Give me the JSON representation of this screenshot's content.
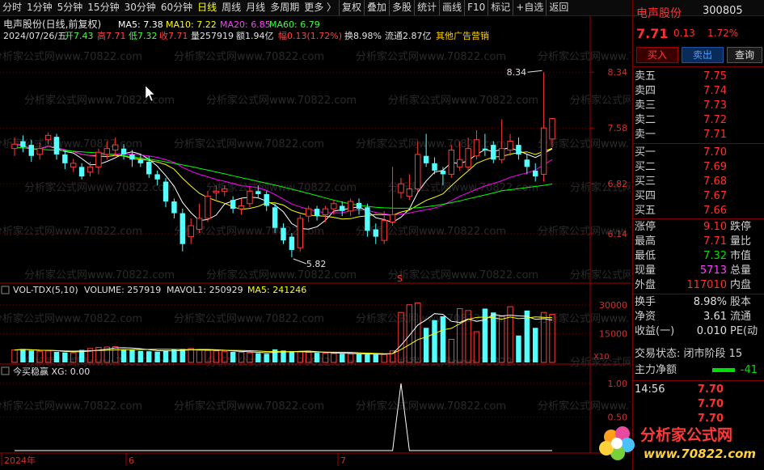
{
  "toolbar": {
    "items": [
      "分时",
      "1分钟",
      "5分钟",
      "15分钟",
      "30分钟",
      "60分钟",
      "日线",
      "周线",
      "月线",
      "多周期",
      "更多 〉",
      "复权",
      "叠加",
      "多股",
      "统计",
      "画线",
      "F10",
      "标记",
      "+自选",
      "返回"
    ],
    "active": "日线"
  },
  "header": {
    "title": "电声股份(日线,前复权)",
    "ma5": "MA5: 7.38",
    "ma10": "MA10: 7.22",
    "ma20": "MA20: 6.85",
    "ma60": "MA60: 6.79",
    "date": "2024/07/26/五",
    "open": "开7.43",
    "high": "高7.71",
    "low": "低7.32",
    "close": "收7.71",
    "vol": "量257919",
    "amount": "额1.94亿",
    "amp": "幅0.13(1.72%)",
    "turnover": "换8.98%",
    "float": "流通2.87亿",
    "sector": "其他广告营销"
  },
  "watermark": "分析家公式网www.70822.com",
  "chart_data": {
    "type": "candlestick",
    "yaxis_ticks": [
      "8.34",
      "7.58",
      "6.82",
      "6.14"
    ],
    "ylim": [
      5.6,
      8.64
    ],
    "high_label": "8.34",
    "low_label": "5.82",
    "marker": "S",
    "candles": [
      {
        "o": 7.3,
        "c": 7.36,
        "h": 7.45,
        "l": 7.2
      },
      {
        "o": 7.4,
        "c": 7.32,
        "h": 7.48,
        "l": 7.25
      },
      {
        "o": 7.35,
        "c": 7.2,
        "h": 7.42,
        "l": 7.12
      },
      {
        "o": 7.22,
        "c": 7.3,
        "h": 7.38,
        "l": 7.15
      },
      {
        "o": 7.42,
        "c": 7.48,
        "h": 7.52,
        "l": 7.36
      },
      {
        "o": 7.46,
        "c": 7.22,
        "h": 7.5,
        "l": 7.15
      },
      {
        "o": 7.22,
        "c": 7.1,
        "h": 7.28,
        "l": 7.02
      },
      {
        "o": 7.05,
        "c": 7.1,
        "h": 7.16,
        "l": 6.98
      },
      {
        "o": 7.05,
        "c": 6.92,
        "h": 7.1,
        "l": 6.88
      },
      {
        "o": 6.98,
        "c": 7.05,
        "h": 7.12,
        "l": 6.92
      },
      {
        "o": 7.05,
        "c": 7.25,
        "h": 7.3,
        "l": 6.95
      },
      {
        "o": 7.22,
        "c": 7.3,
        "h": 7.4,
        "l": 7.15
      },
      {
        "o": 7.28,
        "c": 7.35,
        "h": 7.45,
        "l": 7.2
      },
      {
        "o": 7.3,
        "c": 7.22,
        "h": 7.36,
        "l": 7.15
      },
      {
        "o": 7.22,
        "c": 7.15,
        "h": 7.28,
        "l": 7.05
      },
      {
        "o": 7.15,
        "c": 7.1,
        "h": 7.22,
        "l": 7.05
      },
      {
        "o": 7.12,
        "c": 6.95,
        "h": 7.2,
        "l": 6.9
      },
      {
        "o": 6.95,
        "c": 6.88,
        "h": 7.0,
        "l": 6.8
      },
      {
        "o": 6.85,
        "c": 6.58,
        "h": 6.9,
        "l": 6.5
      },
      {
        "o": 6.58,
        "c": 6.42,
        "h": 6.62,
        "l": 6.35
      },
      {
        "o": 6.42,
        "c": 6.0,
        "h": 6.48,
        "l": 5.9
      },
      {
        "o": 6.1,
        "c": 6.25,
        "h": 6.35,
        "l": 6.0
      },
      {
        "o": 6.2,
        "c": 6.35,
        "h": 6.55,
        "l": 6.15
      },
      {
        "o": 6.35,
        "c": 6.65,
        "h": 6.72,
        "l": 6.3
      },
      {
        "o": 6.7,
        "c": 6.72,
        "h": 6.8,
        "l": 6.58
      },
      {
        "o": 6.72,
        "c": 6.75,
        "h": 6.8,
        "l": 6.65
      },
      {
        "o": 6.6,
        "c": 6.48,
        "h": 6.65,
        "l": 6.42
      },
      {
        "o": 6.48,
        "c": 6.52,
        "h": 6.62,
        "l": 6.4
      },
      {
        "o": 6.55,
        "c": 6.72,
        "h": 6.78,
        "l": 6.5
      },
      {
        "o": 6.72,
        "c": 6.68,
        "h": 6.8,
        "l": 6.62
      },
      {
        "o": 6.68,
        "c": 6.52,
        "h": 6.72,
        "l": 6.45
      },
      {
        "o": 6.5,
        "c": 6.22,
        "h": 6.55,
        "l": 6.15
      },
      {
        "o": 6.22,
        "c": 6.05,
        "h": 6.28,
        "l": 6.0
      },
      {
        "o": 6.1,
        "c": 5.92,
        "h": 6.15,
        "l": 5.82
      },
      {
        "o": 5.95,
        "c": 6.35,
        "h": 6.4,
        "l": 5.9
      },
      {
        "o": 6.38,
        "c": 6.48,
        "h": 6.52,
        "l": 6.3
      },
      {
        "o": 6.48,
        "c": 6.38,
        "h": 6.52,
        "l": 6.32
      },
      {
        "o": 6.4,
        "c": 6.48,
        "h": 6.52,
        "l": 6.3
      },
      {
        "o": 6.48,
        "c": 6.55,
        "h": 6.6,
        "l": 6.4
      },
      {
        "o": 6.52,
        "c": 6.45,
        "h": 6.58,
        "l": 6.38
      },
      {
        "o": 6.45,
        "c": 6.58,
        "h": 6.62,
        "l": 6.38
      },
      {
        "o": 6.56,
        "c": 6.48,
        "h": 6.62,
        "l": 6.4
      },
      {
        "o": 6.5,
        "c": 6.18,
        "h": 6.55,
        "l": 6.1
      },
      {
        "o": 6.2,
        "c": 6.1,
        "h": 6.28,
        "l": 6.0
      },
      {
        "o": 6.05,
        "c": 6.32,
        "h": 6.45,
        "l": 6.0
      },
      {
        "o": 6.3,
        "c": 6.4,
        "h": 7.05,
        "l": 6.25
      },
      {
        "o": 6.7,
        "c": 6.82,
        "h": 6.9,
        "l": 6.62
      },
      {
        "o": 6.65,
        "c": 6.75,
        "h": 6.95,
        "l": 6.6
      },
      {
        "o": 6.75,
        "c": 7.22,
        "h": 7.4,
        "l": 6.7
      },
      {
        "o": 7.2,
        "c": 7.1,
        "h": 7.5,
        "l": 7.05
      },
      {
        "o": 7.1,
        "c": 7.0,
        "h": 7.18,
        "l": 6.95
      },
      {
        "o": 7.0,
        "c": 6.95,
        "h": 7.05,
        "l": 6.8
      },
      {
        "o": 6.95,
        "c": 7.28,
        "h": 7.35,
        "l": 6.9
      },
      {
        "o": 7.05,
        "c": 7.15,
        "h": 7.4,
        "l": 7.0
      },
      {
        "o": 7.05,
        "c": 7.3,
        "h": 7.45,
        "l": 7.0
      },
      {
        "o": 7.2,
        "c": 7.42,
        "h": 7.55,
        "l": 7.15
      },
      {
        "o": 7.3,
        "c": 7.28,
        "h": 7.5,
        "l": 7.2
      },
      {
        "o": 7.35,
        "c": 7.15,
        "h": 7.4,
        "l": 7.1
      },
      {
        "o": 7.15,
        "c": 7.3,
        "h": 7.7,
        "l": 7.1
      },
      {
        "o": 7.28,
        "c": 7.4,
        "h": 7.5,
        "l": 7.2
      },
      {
        "o": 7.35,
        "c": 7.22,
        "h": 7.45,
        "l": 7.15
      },
      {
        "o": 7.15,
        "c": 7.05,
        "h": 7.22,
        "l": 6.95
      },
      {
        "o": 7.0,
        "c": 6.92,
        "h": 7.1,
        "l": 6.85
      },
      {
        "o": 6.95,
        "c": 7.58,
        "h": 8.34,
        "l": 6.85
      },
      {
        "o": 7.43,
        "c": 7.71,
        "h": 7.71,
        "l": 7.32
      }
    ],
    "ma_colors": {
      "ma5": "#ffffff",
      "ma10": "#ffff00",
      "ma20": "#ff00ff",
      "ma60": "#00ff00"
    },
    "volume": {
      "title": "VOL-TDX(5,10)",
      "volume_label": "VOLUME: 257919",
      "mavol1_label": "MAVOL1: 250929",
      "ma5_label": "MA5: 241246",
      "yaxis_ticks": [
        "30000",
        "15000"
      ],
      "unit": "X10",
      "ylim": [
        0,
        32000
      ],
      "values": [
        6500,
        7000,
        6200,
        5800,
        6000,
        5500,
        5200,
        5000,
        6500,
        7200,
        7800,
        8000,
        8200,
        6800,
        6500,
        6000,
        5800,
        5600,
        6200,
        6800,
        7000,
        7200,
        6500,
        6200,
        6000,
        5800,
        5500,
        5200,
        5000,
        4800,
        4500,
        6800,
        6200,
        5800,
        5500,
        5200,
        5000,
        4800,
        4600,
        4500,
        4400,
        4300,
        4200,
        4100,
        4200,
        6000,
        26000,
        30000,
        31000,
        18000,
        22000,
        24000,
        12000,
        28000,
        27000,
        16000,
        28000,
        26000,
        24000,
        29000,
        14000,
        27000,
        18000,
        26000,
        25000
      ]
    },
    "indicator": {
      "title": "今买稳赢 XG: 0.00",
      "yaxis_ticks": [
        "1.00",
        "0.50"
      ],
      "ylim": [
        0,
        1.05
      ],
      "signal_index": 46
    },
    "xaxis_labels": [
      "2024年",
      "6",
      "7"
    ]
  },
  "panel": {
    "name": "电声股份",
    "code": "300805",
    "price": "7.71",
    "change": "0.13",
    "pct": "1.72%",
    "buy_btn": "买入",
    "sell_btn": "卖出",
    "query_btn": "查询",
    "sells": [
      {
        "label": "卖五",
        "price": "7.75"
      },
      {
        "label": "卖四",
        "price": "7.74"
      },
      {
        "label": "卖三",
        "price": "7.73"
      },
      {
        "label": "卖二",
        "price": "7.72"
      },
      {
        "label": "卖一",
        "price": "7.71"
      }
    ],
    "buys": [
      {
        "label": "买一",
        "price": "7.70"
      },
      {
        "label": "买二",
        "price": "7.69"
      },
      {
        "label": "买三",
        "price": "7.68"
      },
      {
        "label": "买四",
        "price": "7.67"
      },
      {
        "label": "买五",
        "price": "7.66"
      }
    ],
    "stats": [
      {
        "l": "涨停",
        "v": "9.10",
        "l2": "跌停"
      },
      {
        "l": "最高",
        "v": "7.71",
        "l2": "量比"
      },
      {
        "l": "最低",
        "v": "7.32",
        "l2": "市值"
      },
      {
        "l": "现量",
        "v": "5713",
        "l2": "总量"
      },
      {
        "l": "外盘",
        "v": "117010",
        "l2": "内盘"
      }
    ],
    "stats2": [
      {
        "l": "换手",
        "v": "8.98%",
        "l2": "股本"
      },
      {
        "l": "净资",
        "v": "3.61",
        "l2": "流通"
      },
      {
        "l": "收益(一)",
        "v": "0.010",
        "l2": "PE(动"
      }
    ],
    "trade_status": "交易状态: 闭市阶段 15",
    "main_net": "主力净额",
    "main_net_val": "-41",
    "ticks": [
      {
        "t": "14:56",
        "p": "7.70"
      },
      {
        "t": "",
        "p": "7.70"
      },
      {
        "t": "",
        "p": "7.70"
      }
    ]
  },
  "logo": {
    "text1": "分析家公式网",
    "text2": "www.70822.com"
  }
}
